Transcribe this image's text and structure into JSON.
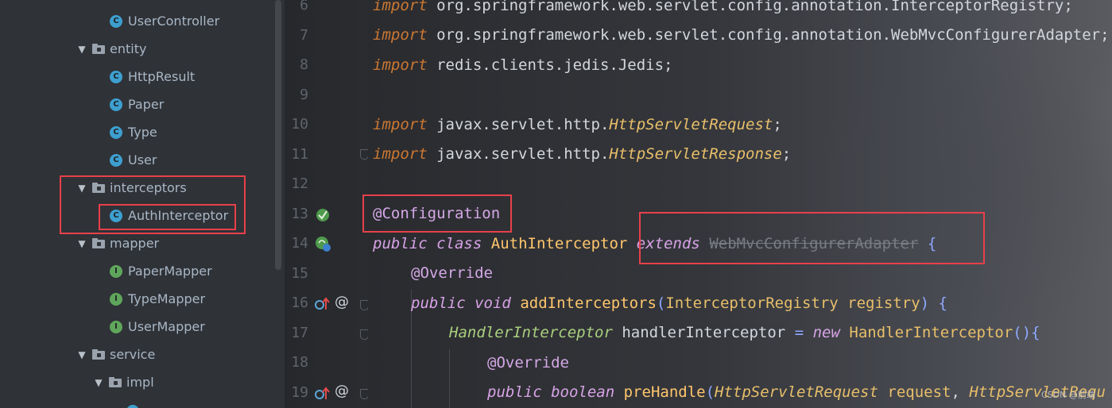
{
  "tree": {
    "items": [
      {
        "label": "UserController",
        "kind": "class"
      },
      {
        "label": "entity",
        "kind": "package"
      },
      {
        "label": "HttpResult",
        "kind": "class"
      },
      {
        "label": "Paper",
        "kind": "class"
      },
      {
        "label": "Type",
        "kind": "class"
      },
      {
        "label": "User",
        "kind": "class"
      },
      {
        "label": "interceptors",
        "kind": "package"
      },
      {
        "label": "AuthInterceptor",
        "kind": "class"
      },
      {
        "label": "mapper",
        "kind": "package"
      },
      {
        "label": "PaperMapper",
        "kind": "interface"
      },
      {
        "label": "TypeMapper",
        "kind": "interface"
      },
      {
        "label": "UserMapper",
        "kind": "interface"
      },
      {
        "label": "service",
        "kind": "package"
      },
      {
        "label": "impl",
        "kind": "package"
      }
    ],
    "badges": {
      "class": "C",
      "interface": "I"
    }
  },
  "editor": {
    "line_numbers": [
      "6",
      "7",
      "8",
      "9",
      "10",
      "11",
      "12",
      "13",
      "14",
      "15",
      "16",
      "17",
      "18",
      "19"
    ],
    "lines": {
      "l6": {
        "kw": "import",
        "text": " org.springframework.web.servlet.config.annotation.InterceptorRegistry;"
      },
      "l7": {
        "kw": "import",
        "text": " org.springframework.web.servlet.config.annotation.WebMvcConfigurerAdapter;"
      },
      "l8": {
        "kw": "import",
        "text": " redis.clients.jedis.Jedis;"
      },
      "l10": {
        "kw": "import",
        "pkg": " javax.servlet.http.",
        "cls": "HttpServletRequest",
        "end": ";"
      },
      "l11": {
        "kw": "import",
        "pkg": " javax.servlet.http.",
        "cls": "HttpServletResponse",
        "end": ";"
      },
      "l13": {
        "annotation": "@Configuration"
      },
      "l14": {
        "kw1": "public",
        "kw2": "class",
        "name": "AuthInterceptor",
        "extends": "extends",
        "parent": "WebMvcConfigurerAdapter",
        "brace": "{"
      },
      "l15": {
        "annotation": "@Override"
      },
      "l16": {
        "kw1": "public",
        "kw2": "void",
        "method": "addInterceptors",
        "open": "(",
        "ptype": "InterceptorRegistry",
        "pname": "registry",
        "close": ") {"
      },
      "l17": {
        "type": "HandlerInterceptor",
        "var": " handlerInterceptor ",
        "eq": "=",
        "new": "new",
        "ctor": "HandlerInterceptor",
        "tail": "(){"
      },
      "l18": {
        "annotation": "@Override"
      },
      "l19": {
        "kw1": "public",
        "kw2": "boolean",
        "method": "preHandle",
        "open": "(",
        "ptype": "HttpServletRequest",
        "pname": "request",
        "comma": ",",
        "ptype2": "HttpServletRequ"
      }
    }
  },
  "gutter_icons": {
    "l13": "spring-bean-icon",
    "l14": "spring-bean-icon",
    "l16": "override-method-icon",
    "l19": "override-method-icon",
    "at_symbol": "@"
  },
  "watermark": "CSDN @前端"
}
